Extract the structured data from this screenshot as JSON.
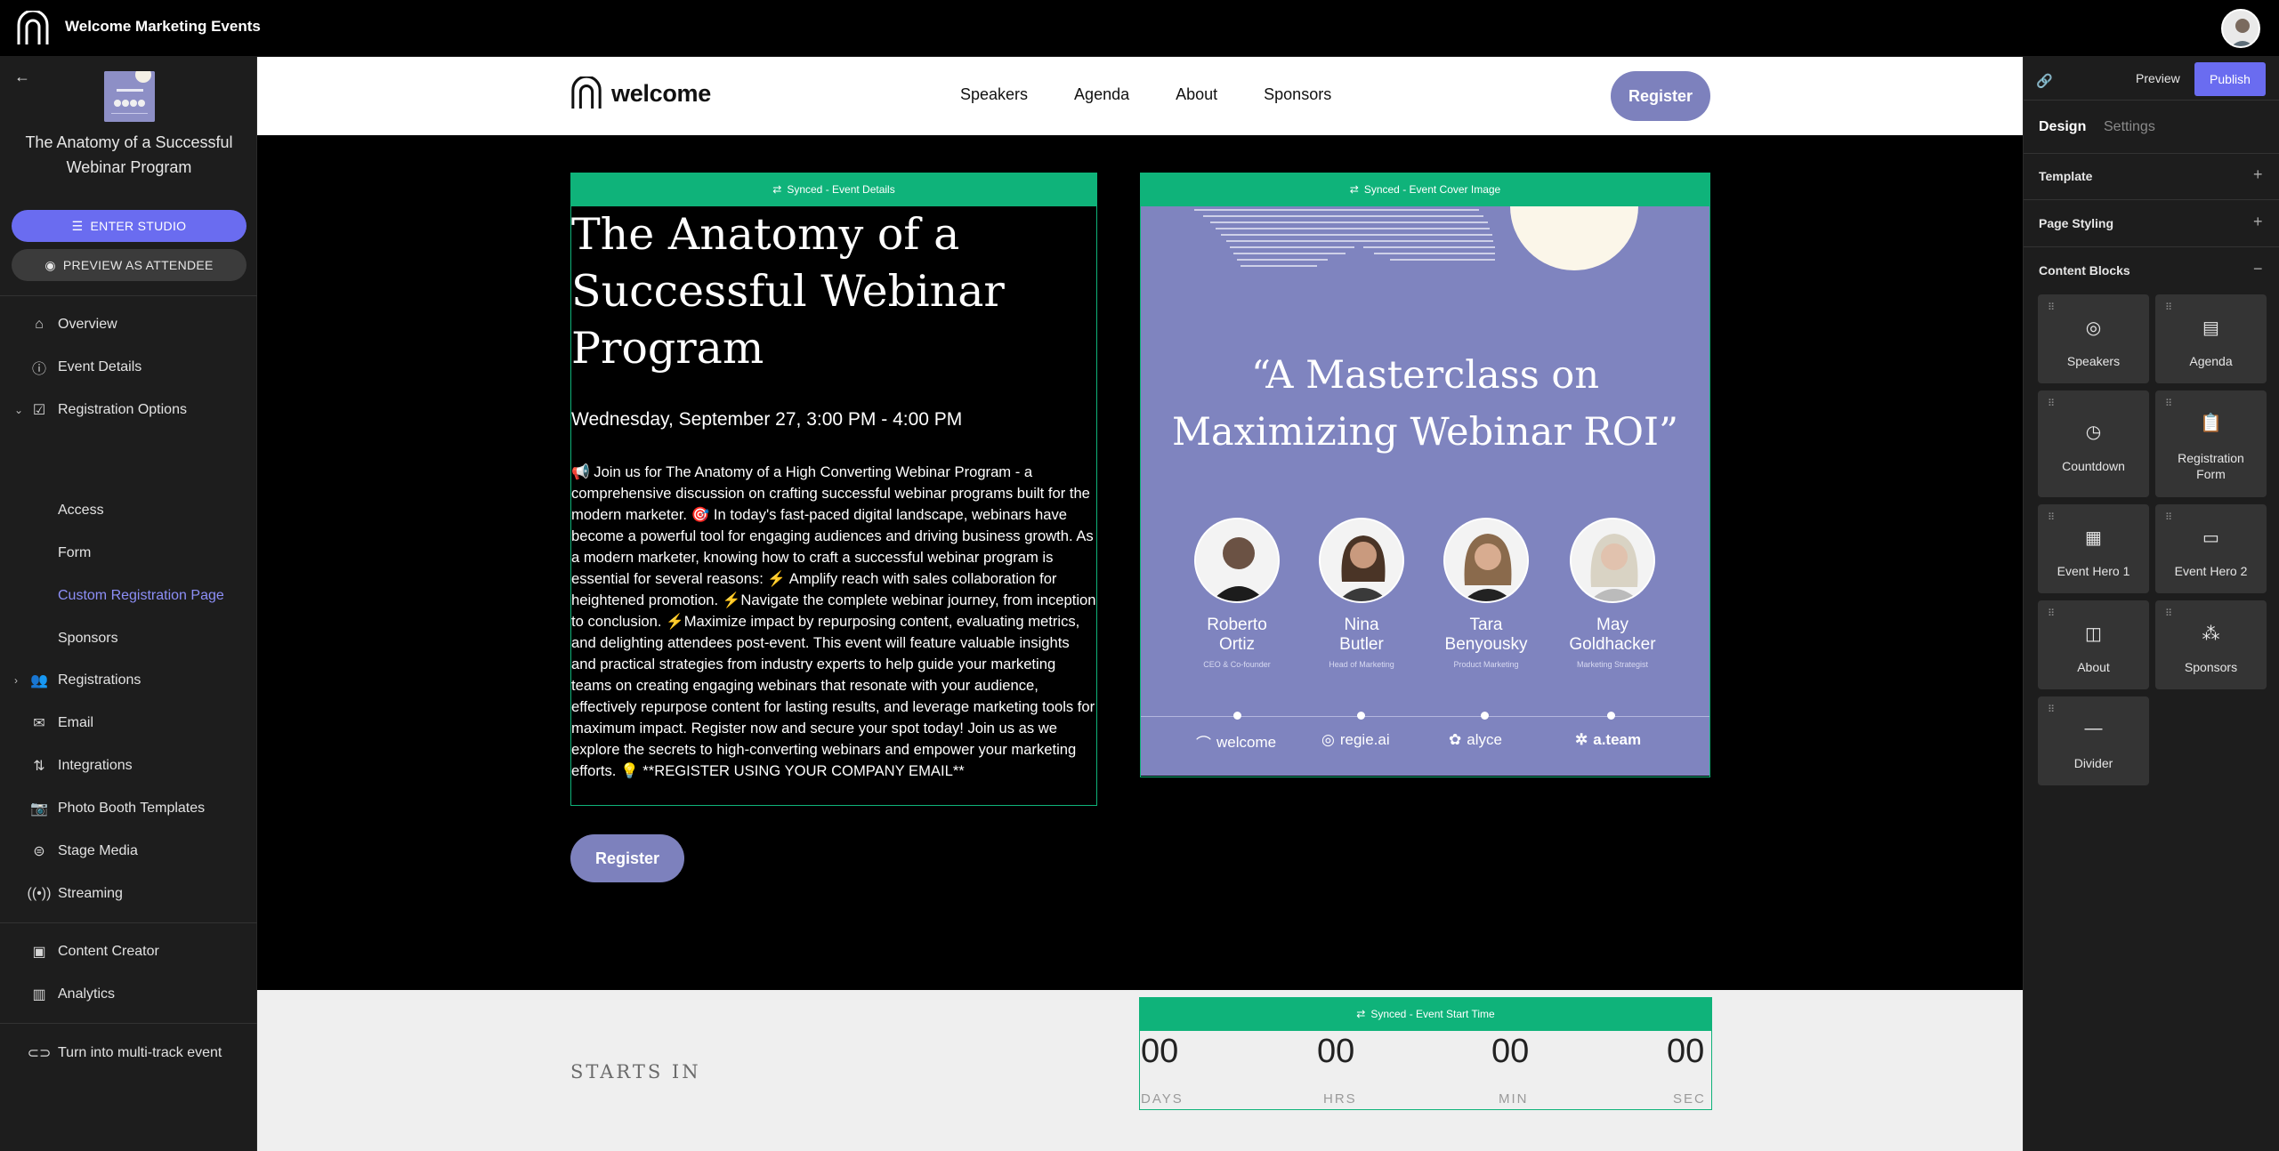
{
  "topbar": {
    "title": "Welcome Marketing Events"
  },
  "sidebar": {
    "event_title": "The Anatomy of a Successful Webinar Program",
    "enter_studio": "ENTER STUDIO",
    "preview_attendee": "PREVIEW AS ATTENDEE",
    "items": [
      {
        "label": "Overview",
        "icon": "home-icon"
      },
      {
        "label": "Event Details",
        "icon": "info-icon"
      },
      {
        "label": "Registration Options",
        "icon": "checkbox-icon"
      },
      {
        "label": "Access"
      },
      {
        "label": "Form"
      },
      {
        "label": "Custom Registration Page"
      },
      {
        "label": "Sponsors"
      },
      {
        "label": "Registrations",
        "icon": "people-icon"
      },
      {
        "label": "Email",
        "icon": "mail-icon"
      },
      {
        "label": "Integrations",
        "icon": "integrations-icon"
      },
      {
        "label": "Photo Booth Templates",
        "icon": "camera-icon"
      },
      {
        "label": "Stage Media",
        "icon": "stage-media-icon"
      },
      {
        "label": "Streaming",
        "icon": "broadcast-icon"
      },
      {
        "label": "Content Creator",
        "icon": "content-creator-icon"
      },
      {
        "label": "Analytics",
        "icon": "bar-chart-icon"
      },
      {
        "label": "Turn into multi-track event",
        "icon": "link-icon"
      }
    ]
  },
  "site": {
    "brand": "welcome",
    "nav": [
      "Speakers",
      "Agenda",
      "About",
      "Sponsors"
    ],
    "register": "Register",
    "synced_details": "Synced - Event Details",
    "synced_cover": "Synced - Event Cover Image",
    "synced_time": "Synced - Event Start Time",
    "title": "The Anatomy of a Successful Webinar Program",
    "date": "Wednesday, September 27, 3:00 PM - 4:00 PM",
    "description": "📢 Join us for The Anatomy of a High Converting Webinar Program - a comprehensive discussion on crafting successful webinar programs built for the modern marketer. 🎯 In today's fast-paced digital landscape, webinars have become a powerful tool for engaging audiences and driving business growth. As a modern marketer, knowing how to craft a successful webinar program is essential for several reasons: ⚡ Amplify reach with sales collaboration for heightened promotion. ⚡Navigate the complete webinar journey, from inception to conclusion. ⚡Maximize impact by repurposing content, evaluating metrics, and delighting attendees post-event. This event will feature valuable insights and practical strategies from industry experts to help guide your marketing teams on creating engaging webinars that resonate with your audience, effectively repurpose content for lasting results, and leverage marketing tools for maximum impact. Register now and secure your spot today! Join us as we explore the secrets to high-converting webinars and empower your marketing efforts. 💡 **REGISTER USING YOUR COMPANY EMAIL**",
    "cta": "Register",
    "cover": {
      "quote": "“A Masterclass on Maximizing Webinar ROI”",
      "speakers": [
        {
          "first": "Roberto",
          "last": "Ortiz",
          "role": "CEO & Co-founder"
        },
        {
          "first": "Nina",
          "last": "Butler",
          "role": "Head of Marketing"
        },
        {
          "first": "Tara",
          "last": "Benyousky",
          "role": "Product Marketing"
        },
        {
          "first": "May",
          "last": "Goldhacker",
          "role": "Marketing Strategist"
        }
      ],
      "logos": [
        "welcome",
        "regie.ai",
        "alyce",
        "a.team"
      ]
    },
    "countdown": {
      "starts_in": "STARTS IN",
      "units": [
        {
          "value": "00",
          "label": "DAYS"
        },
        {
          "value": "00",
          "label": "HRS"
        },
        {
          "value": "00",
          "label": "MIN"
        },
        {
          "value": "00",
          "label": "SEC"
        }
      ]
    }
  },
  "panel": {
    "preview": "Preview",
    "publish": "Publish",
    "tabs": [
      "Design",
      "Settings"
    ],
    "sections": [
      "Template",
      "Page Styling",
      "Content Blocks"
    ],
    "blocks": [
      {
        "label": "Speakers",
        "icon": "speakers-icon"
      },
      {
        "label": "Agenda",
        "icon": "agenda-icon"
      },
      {
        "label": "Countdown",
        "icon": "clock-icon"
      },
      {
        "label": "Registration Form",
        "icon": "clipboard-icon"
      },
      {
        "label": "Event Hero 1",
        "icon": "layout-icon"
      },
      {
        "label": "Event Hero 2",
        "icon": "window-icon"
      },
      {
        "label": "About",
        "icon": "book-icon"
      },
      {
        "label": "Sponsors",
        "icon": "sponsors-icon"
      },
      {
        "label": "Divider",
        "icon": "divider-icon"
      }
    ]
  }
}
